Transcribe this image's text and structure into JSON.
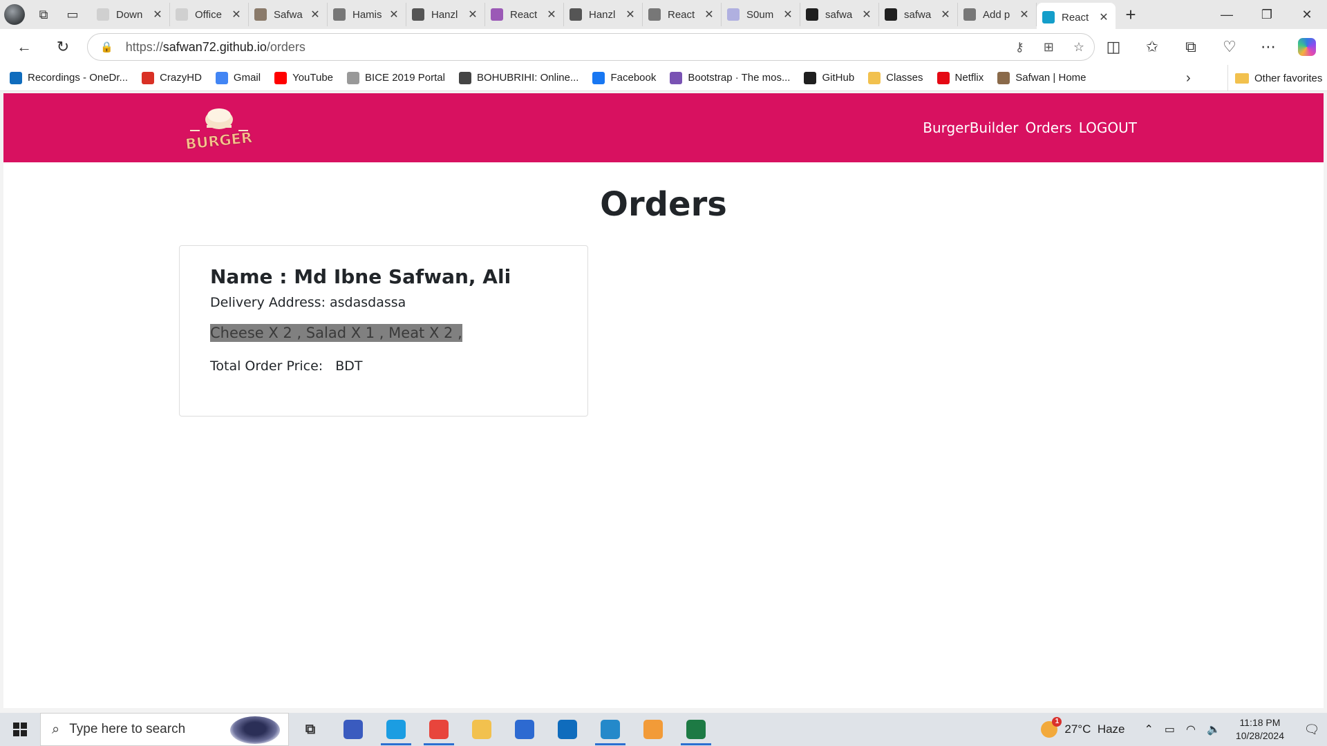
{
  "browser": {
    "tabs": [
      {
        "title": "Down",
        "icon": "settings-gear-icon",
        "color": "#d0d0d0"
      },
      {
        "title": "Office",
        "icon": "document-icon",
        "color": "#d0d0d0"
      },
      {
        "title": "Safwa",
        "icon": "avatar-icon",
        "color": "#8a7a6a"
      },
      {
        "title": "Hamis",
        "icon": "wikipedia-icon",
        "color": "#777777"
      },
      {
        "title": "Hanzl",
        "icon": "code-icon",
        "color": "#555555"
      },
      {
        "title": "React",
        "icon": "vite-icon",
        "color": "#9b59b6"
      },
      {
        "title": "Hanzl",
        "icon": "code-icon",
        "color": "#555555"
      },
      {
        "title": "React",
        "icon": "page-icon",
        "color": "#777777"
      },
      {
        "title": "S0um",
        "icon": "spinner-icon",
        "color": "#b0b0e0"
      },
      {
        "title": "safwa",
        "icon": "github-icon",
        "color": "#1f1f1f"
      },
      {
        "title": "safwa",
        "icon": "github-icon",
        "color": "#1f1f1f"
      },
      {
        "title": "Add p",
        "icon": "page-icon",
        "color": "#777777"
      },
      {
        "title": "React",
        "icon": "react-icon",
        "color": "#149eca",
        "active": true
      }
    ],
    "url": {
      "scheme": "https://",
      "host": "safwan72.github.io",
      "path": "/orders"
    },
    "bookmarks": [
      {
        "label": "Recordings - OneDr...",
        "icon": "onedrive-icon",
        "color": "#0f6cbd"
      },
      {
        "label": "CrazyHD",
        "icon": "hd-icon",
        "color": "#d93025"
      },
      {
        "label": "Gmail",
        "icon": "google-icon",
        "color": "#4285f4"
      },
      {
        "label": "YouTube",
        "icon": "youtube-icon",
        "color": "#ff0000"
      },
      {
        "label": "BICE 2019 Portal",
        "icon": "hexagon-icon",
        "color": "#999999"
      },
      {
        "label": "BOHUBRIHI: Online...",
        "icon": "pen-icon",
        "color": "#444444"
      },
      {
        "label": "Facebook",
        "icon": "facebook-icon",
        "color": "#1877f2"
      },
      {
        "label": "Bootstrap · The mos...",
        "icon": "bootstrap-icon",
        "color": "#7952b3"
      },
      {
        "label": "GitHub",
        "icon": "github-icon",
        "color": "#1f1f1f"
      },
      {
        "label": "Classes",
        "icon": "classroom-icon",
        "color": "#f2c14e"
      },
      {
        "label": "Netflix",
        "icon": "netflix-icon",
        "color": "#e50914"
      },
      {
        "label": "Safwan | Home",
        "icon": "avatar-icon",
        "color": "#8a6a4a"
      }
    ],
    "other_favorites": "Other favorites"
  },
  "app": {
    "brand": {
      "logo_text": "BURGER",
      "color": "#d81160"
    },
    "nav": {
      "burger_builder": "BurgerBuilder",
      "orders": "Orders",
      "logout": "LOGOUT"
    },
    "page_title": "Orders",
    "orders": [
      {
        "name": "Name : Md Ibne Safwan, Ali",
        "address": "Delivery Address: asdasdassa",
        "items": "Cheese X 2 , Salad X 1 , Meat X 2 ,",
        "total_label": "Total Order Price:",
        "total_currency": "BDT"
      }
    ]
  },
  "taskbar": {
    "search_placeholder": "Type here to search",
    "apps": [
      {
        "name": "task-view-icon",
        "running": false
      },
      {
        "name": "network-tool-icon",
        "running": false
      },
      {
        "name": "edge-icon",
        "running": true
      },
      {
        "name": "chrome-icon",
        "running": true
      },
      {
        "name": "file-explorer-icon",
        "running": false
      },
      {
        "name": "microsoft-store-icon",
        "running": false
      },
      {
        "name": "outlook-icon",
        "running": false
      },
      {
        "name": "vscode-icon",
        "running": true
      },
      {
        "name": "paint-icon",
        "running": false
      },
      {
        "name": "excel-icon",
        "running": true
      }
    ],
    "weather": {
      "temp": "27°C",
      "condition": "Haze",
      "alert_count": "1"
    },
    "clock": {
      "time": "11:18 PM",
      "date": "10/28/2024"
    }
  }
}
